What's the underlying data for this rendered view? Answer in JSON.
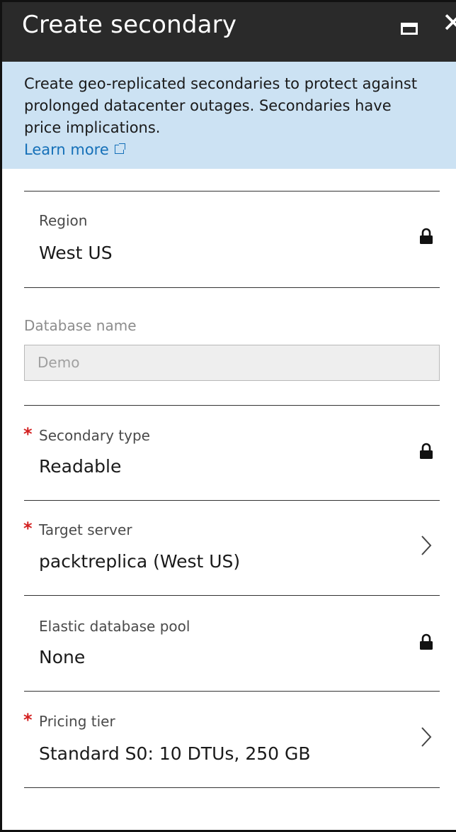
{
  "header": {
    "title": "Create secondary",
    "maximize_icon": "maximize-icon",
    "close_icon": "close-icon"
  },
  "info": {
    "text": "Create geo-replicated secondaries to protect against prolonged datacenter outages. Secondaries have price implications.",
    "learn_more": "Learn more",
    "link_icon": "external-link-icon"
  },
  "fields": {
    "region": {
      "label": "Region",
      "value": "West US",
      "icon": "lock-icon",
      "required": false
    },
    "database_name": {
      "label": "Database name",
      "value": "Demo",
      "disabled": true
    },
    "secondary_type": {
      "label": "Secondary type",
      "value": "Readable",
      "icon": "lock-icon",
      "required": true
    },
    "target_server": {
      "label": "Target server",
      "value": "packtreplica (West US)",
      "icon": "chevron-right-icon",
      "required": true
    },
    "elastic_pool": {
      "label": "Elastic database pool",
      "value": "None",
      "icon": "lock-icon",
      "required": false
    },
    "pricing_tier": {
      "label": "Pricing tier",
      "value": "Standard S0: 10 DTUs, 250 GB",
      "icon": "chevron-right-icon",
      "required": true
    }
  },
  "required_marker": "*",
  "colors": {
    "header_bg": "#2a2a2a",
    "info_bg": "#cce2f3",
    "link": "#1570b8",
    "required": "#d32020"
  }
}
